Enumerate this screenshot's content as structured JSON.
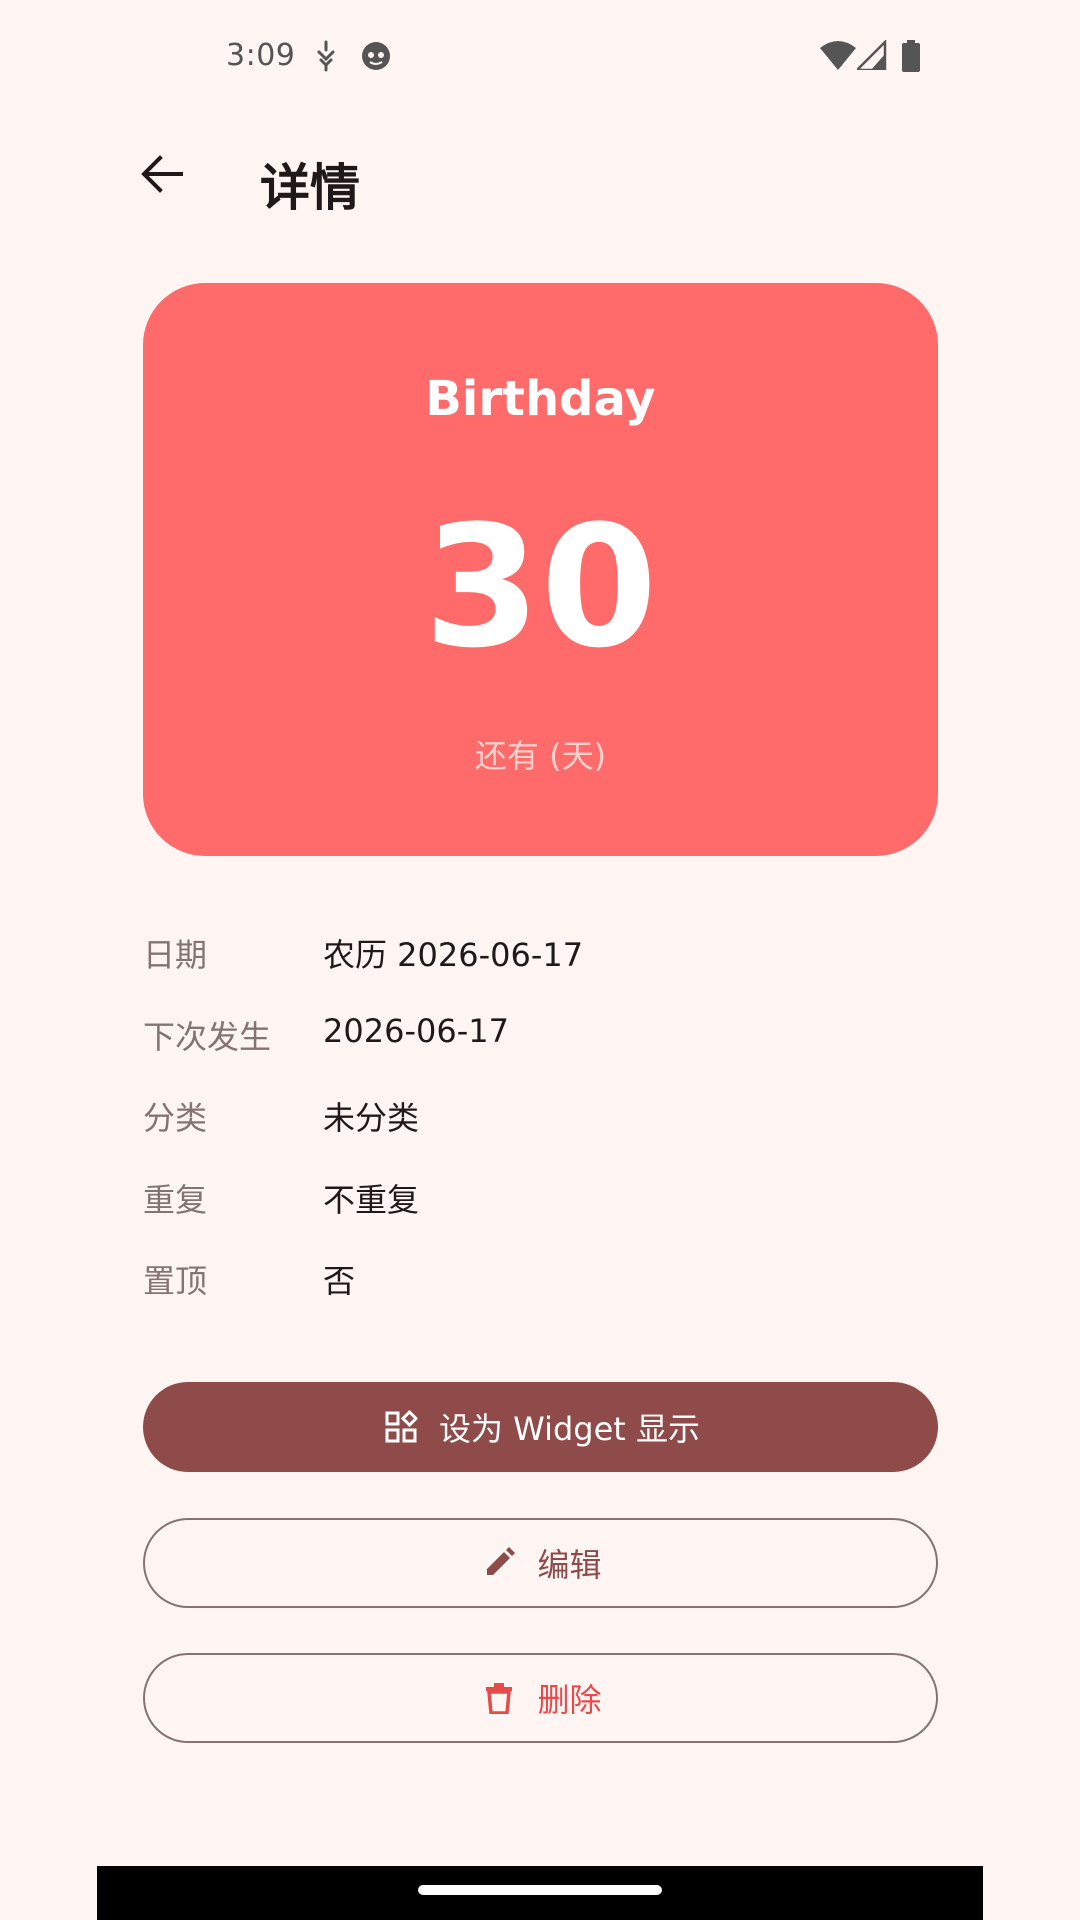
{
  "status_bar": {
    "time": "3:09",
    "icons": [
      "pin-icon",
      "face-icon",
      "wifi-icon",
      "cell-signal-icon",
      "battery-icon"
    ]
  },
  "top_bar": {
    "back_icon": "arrow-back-icon",
    "title": "详情"
  },
  "event_card": {
    "title": "Birthday",
    "days": "30",
    "days_label": "还有 (天)",
    "background_color": "#FF6B6B"
  },
  "details": {
    "date": {
      "label": "日期",
      "value": "农历 2026-06-17"
    },
    "next_occurrence": {
      "label": "下次发生",
      "value": "2026-06-17"
    },
    "category": {
      "label": "分类",
      "value": "未分类"
    },
    "repeat": {
      "label": "重复",
      "value": "不重复"
    },
    "pinned": {
      "label": "置顶",
      "value": "否"
    }
  },
  "actions": {
    "widget": {
      "label": "设为 Widget 显示",
      "icon": "widgets-icon"
    },
    "edit": {
      "label": "编辑",
      "icon": "pencil-icon"
    },
    "delete": {
      "label": "删除",
      "icon": "trash-icon"
    }
  },
  "colors": {
    "background": "#FFF6F4",
    "primary": "#8F4A4A",
    "danger": "#E84A4A",
    "card": "#FF6B6B"
  }
}
